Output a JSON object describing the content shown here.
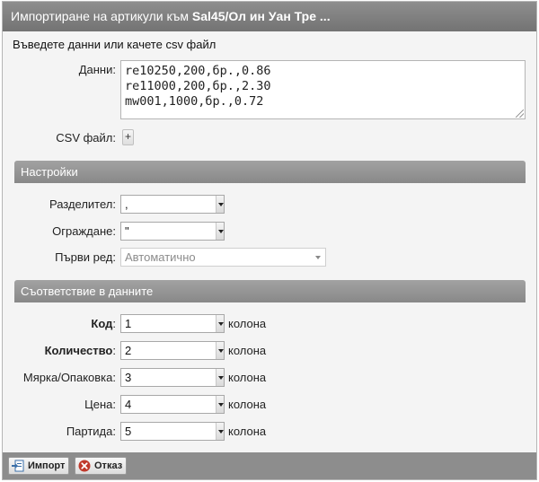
{
  "dialog": {
    "title_prefix": "Импортиране на артикули към ",
    "title_bold": "Sal45/Ол ин Уан Тре ..."
  },
  "intro_text": "Въведете данни или качете csv файл",
  "data_field": {
    "label": "Данни:",
    "lines": [
      "re10250,200,бр.,0.86",
      "re11000,200,бр.,2.30",
      "mw001,1000,бр.,0.72"
    ]
  },
  "csv_file": {
    "label": "CSV файл:",
    "button": "+"
  },
  "settings": {
    "header": "Настройки",
    "delimiter": {
      "label": "Разделител:",
      "value": ","
    },
    "enclosure": {
      "label": "Ограждане:",
      "value": "\""
    },
    "first_row": {
      "label": "Първи ред:",
      "value": "Автоматично"
    }
  },
  "mapping": {
    "header": "Съответствие в данните",
    "suffix": "колона",
    "rows": [
      {
        "label": "Код",
        "colon": ":",
        "value": "1",
        "required": true
      },
      {
        "label": "Количество",
        "colon": ":",
        "value": "2",
        "required": true
      },
      {
        "label": "Мярка/Опаковка:",
        "colon": "",
        "value": "3",
        "required": false
      },
      {
        "label": "Цена:",
        "colon": "",
        "value": "4",
        "required": false
      },
      {
        "label": "Партида:",
        "colon": "",
        "value": "5",
        "required": false
      }
    ]
  },
  "footer": {
    "import_label": "Импорт",
    "cancel_label": "Отказ"
  },
  "colors": {
    "titlebar": "#7f7f7f",
    "section": "#959595",
    "footer": "#8d8d8d",
    "cancel_icon": "#c0392b",
    "import_icon": "#3b6fa8"
  }
}
